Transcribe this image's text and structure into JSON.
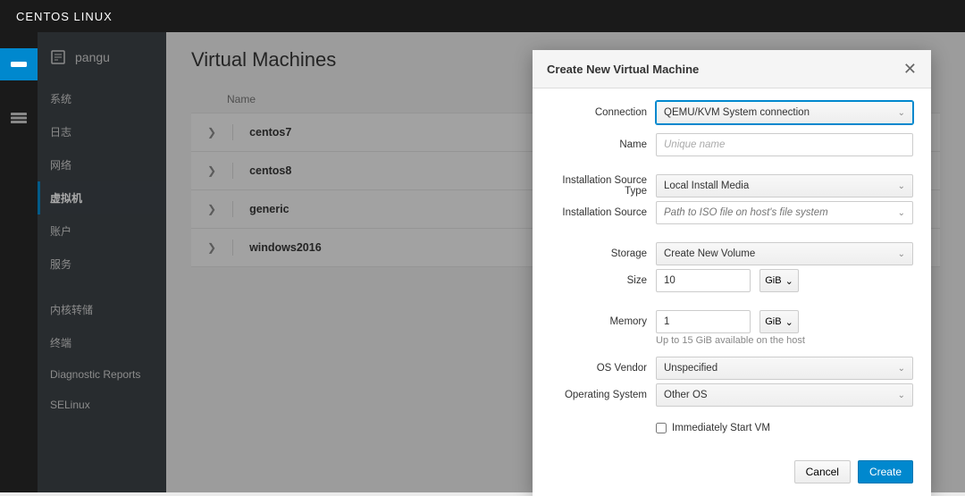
{
  "topbar": {
    "title": "CENTOS LINUX"
  },
  "sidebar": {
    "hostname": "pangu",
    "items": [
      {
        "label": "系统",
        "key": "system"
      },
      {
        "label": "日志",
        "key": "logs"
      },
      {
        "label": "网络",
        "key": "network"
      },
      {
        "label": "虚拟机",
        "key": "vms",
        "active": true
      },
      {
        "label": "账户",
        "key": "accounts"
      },
      {
        "label": "服务",
        "key": "services"
      }
    ],
    "items2": [
      {
        "label": "内核转储",
        "key": "kdump"
      },
      {
        "label": "终端",
        "key": "terminal"
      },
      {
        "label": "Diagnostic Reports",
        "key": "diag"
      },
      {
        "label": "SELinux",
        "key": "selinux"
      }
    ]
  },
  "content": {
    "title": "Virtual Machines",
    "column_name": "Name",
    "vms": [
      {
        "name": "centos7"
      },
      {
        "name": "centos8"
      },
      {
        "name": "generic"
      },
      {
        "name": "windows2016"
      }
    ]
  },
  "modal": {
    "title": "Create New Virtual Machine",
    "labels": {
      "connection": "Connection",
      "name": "Name",
      "install_type": "Installation Source Type",
      "install_src": "Installation Source",
      "storage": "Storage",
      "size": "Size",
      "memory": "Memory",
      "os_vendor": "OS Vendor",
      "os": "Operating System"
    },
    "values": {
      "connection": "QEMU/KVM System connection",
      "install_type": "Local Install Media",
      "storage": "Create New Volume",
      "size": "10",
      "size_unit": "GiB",
      "memory": "1",
      "memory_unit": "GiB",
      "os_vendor": "Unspecified",
      "os": "Other OS"
    },
    "placeholders": {
      "name": "Unique name",
      "install_src": "Path to ISO file on host's file system"
    },
    "memory_hint": "Up to 15 GiB available on the host",
    "immediate_label": "Immediately Start VM",
    "cancel_label": "Cancel",
    "create_label": "Create"
  }
}
